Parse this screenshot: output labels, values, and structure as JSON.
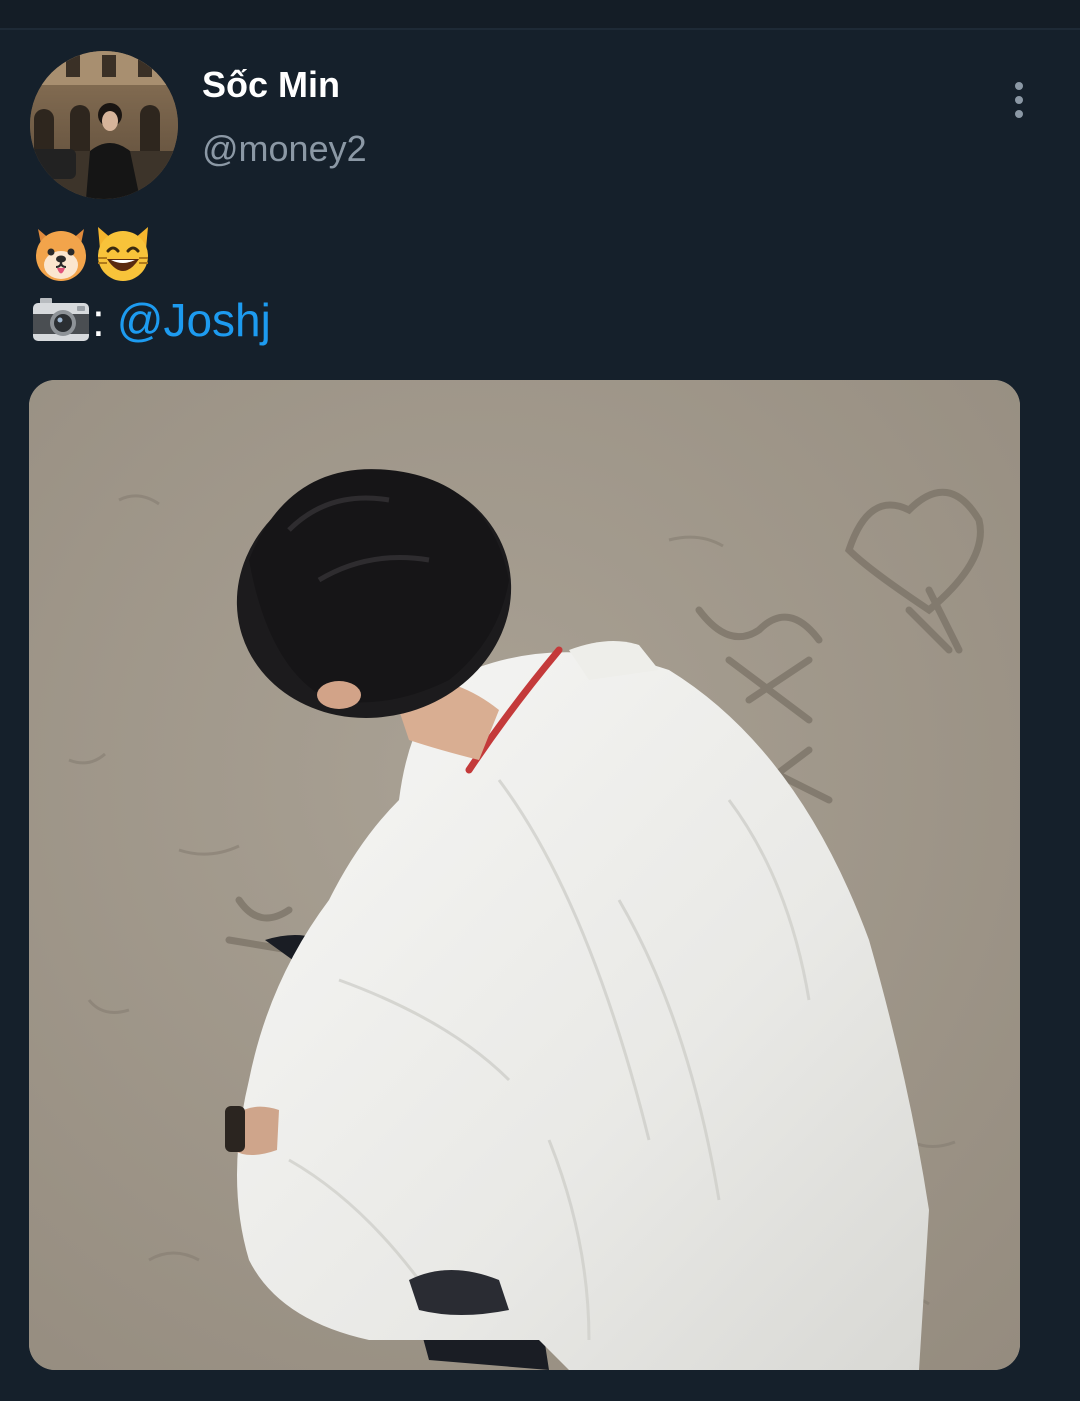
{
  "tweet": {
    "author": {
      "display_name": "Sốc Min",
      "handle": "@money2"
    },
    "emojis": [
      "dog-face-emoji",
      "grinning-cat-emoji"
    ],
    "credit": {
      "icon": "camera-emoji",
      "separator": ":",
      "mention": "@Joshj"
    },
    "photo": {
      "description_icon": "beach-photo"
    }
  }
}
